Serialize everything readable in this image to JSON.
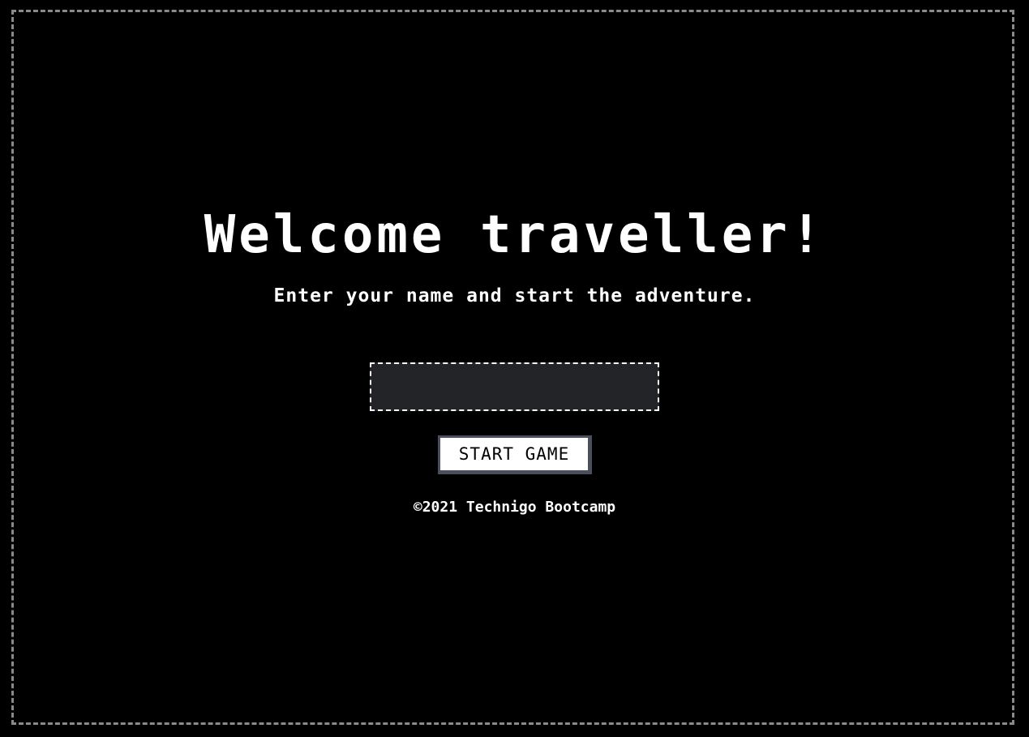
{
  "welcome": {
    "title": "Welcome traveller!",
    "subtitle": "Enter your name and start the adventure."
  },
  "form": {
    "name_value": "",
    "name_placeholder": "",
    "start_label": "START GAME"
  },
  "footer": {
    "text": "©2021 Technigo Bootcamp"
  },
  "colors": {
    "background": "#000000",
    "frame_border": "#8a8a8a",
    "input_background": "#222427",
    "text": "#ffffff",
    "button_background": "#ffffff",
    "button_border": "#4a4f5c"
  }
}
